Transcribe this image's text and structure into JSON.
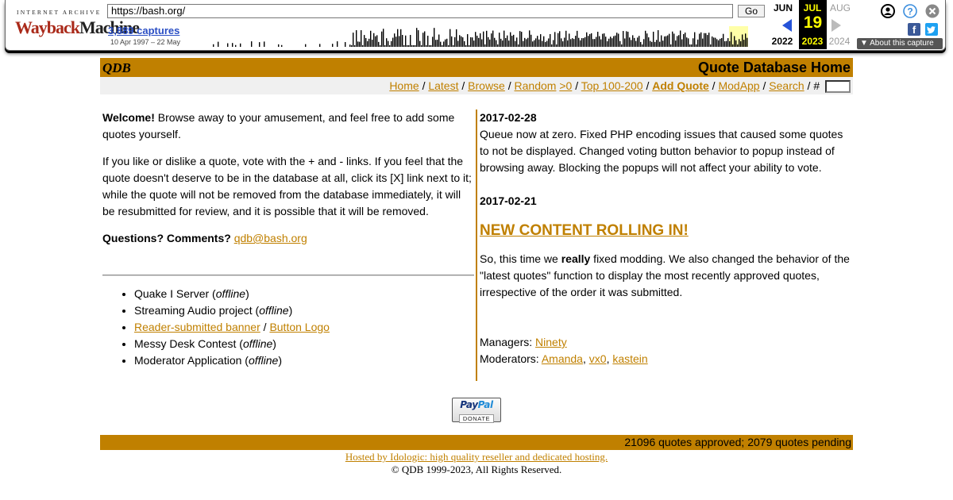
{
  "wayback": {
    "brand_top": "INTERNET ARCHIVE",
    "brand_logo_a": "Wayback",
    "brand_logo_b": "Machine",
    "url": "https://bash.org/",
    "go_label": "Go",
    "captures_label": "3,889 captures",
    "date_range": "10 Apr 1997 – 22 May",
    "prev_month": "JUN",
    "cur_month": "JUL",
    "next_month": "AUG",
    "cur_day": "19",
    "prev_year": "2022",
    "cur_year": "2023",
    "next_year": "2024",
    "about_label": "About this capture",
    "facebook_glyph": "f",
    "icons": [
      "user-icon",
      "help-icon",
      "close-icon",
      "facebook-icon",
      "twitter-icon",
      "prev-arrow-icon",
      "next-arrow-icon"
    ]
  },
  "qdb": {
    "logo": "QDB",
    "title": "Quote Database Home",
    "accent_color": "#c08000",
    "nav": {
      "home": "Home",
      "latest": "Latest",
      "browse": "Browse",
      "random": "Random",
      "random_gt0": ">0",
      "top": "Top 100-200",
      "add_quote": "Add Quote",
      "modapp": "ModApp",
      "search": "Search",
      "hash": "#",
      "sep": "/"
    },
    "welcome": {
      "bold": "Welcome!",
      "text": " Browse away to your amusement, and feel free to add some quotes yourself."
    },
    "vote_text": "If you like or dislike a quote, vote with the + and - links. If you feel that the quote doesn't deserve to be in the database at all, click its [X] link next to it; while the quote will not be removed from the database immediately, it will be resubmitted for review, and it is possible that it will be removed.",
    "questions_label": "Questions? Comments?",
    "contact_email": "qdb@bash.org",
    "links": {
      "quake_label": "Quake I Server",
      "streaming_label": "Streaming Audio project",
      "banner_link": "Reader-submitted banner",
      "slash": "/",
      "logo_link": "Button Logo",
      "messy_label": "Messy Desk Contest",
      "moderator_label": "Moderator Application",
      "offline": "offline",
      "open_paren": " (",
      "close_paren": ")"
    },
    "news": [
      {
        "date": "2017-02-28",
        "body": "Queue now at zero. Fixed PHP encoding issues that caused some quotes to not be displayed. Changed voting button behavior to popup instead of browsing away. Blocking the popups will not affect your ability to vote."
      },
      {
        "date": "2017-02-21",
        "heading": "NEW CONTENT ROLLING IN!",
        "body_a": "So, this time we ",
        "body_bold": "really",
        "body_b": " fixed modding. We also changed the behavior of the \"latest quotes\" function to display the most recently approved quotes, irrespective of the order it was submitted."
      }
    ],
    "managers_label": "Managers:",
    "managers": [
      "Ninety"
    ],
    "moderators_label": "Moderators:",
    "moderators": [
      "Amanda",
      "vx0",
      "kastein"
    ],
    "comma": ",",
    "paypal_logo_a": "Pay",
    "paypal_logo_b": "Pal",
    "paypal_donate": "DONATE",
    "footer_stats": "21096 quotes approved; 2079 quotes pending",
    "hosted_text": "Hosted by Idologic: high quality reseller and dedicated hosting.",
    "copyright": "© QDB 1999-2023, All Rights Reserved."
  }
}
